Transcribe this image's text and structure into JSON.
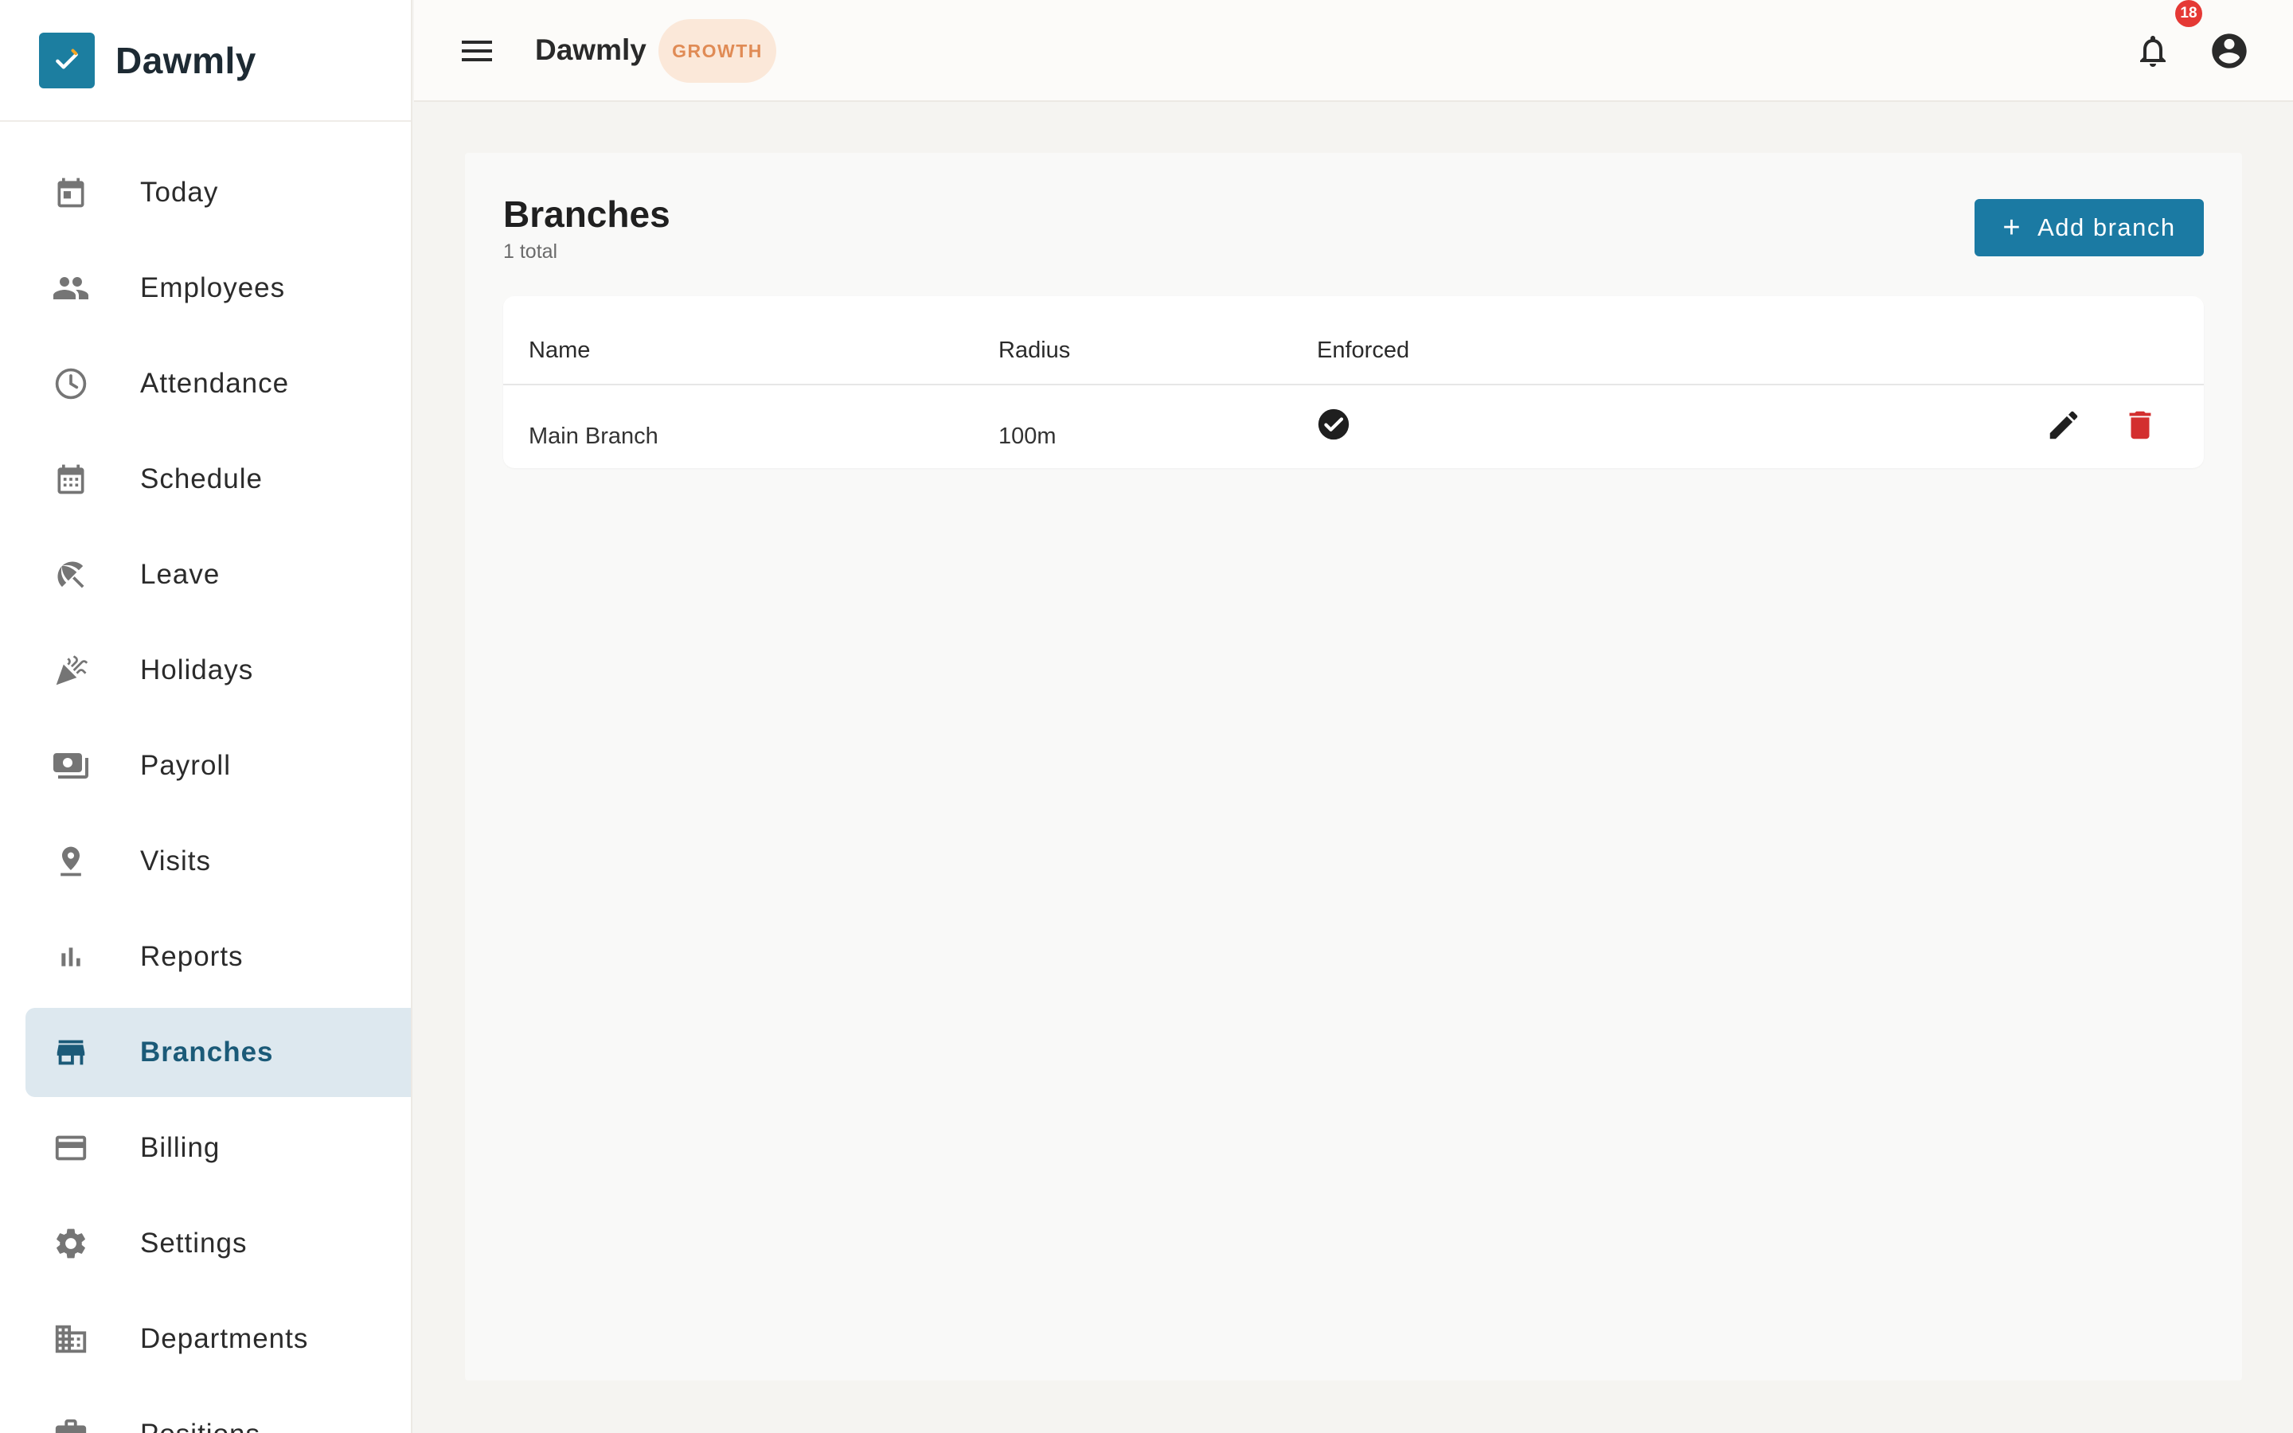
{
  "brand": {
    "name": "Dawmly"
  },
  "sidebar": {
    "items": [
      {
        "label": "Today",
        "icon": "calendar-today-icon"
      },
      {
        "label": "Employees",
        "icon": "people-icon"
      },
      {
        "label": "Attendance",
        "icon": "clock-icon"
      },
      {
        "label": "Schedule",
        "icon": "calendar-grid-icon"
      },
      {
        "label": "Leave",
        "icon": "beach-umbrella-icon"
      },
      {
        "label": "Holidays",
        "icon": "party-popper-icon"
      },
      {
        "label": "Payroll",
        "icon": "money-icon"
      },
      {
        "label": "Visits",
        "icon": "location-pin-icon"
      },
      {
        "label": "Reports",
        "icon": "bar-chart-icon"
      },
      {
        "label": "Branches",
        "icon": "storefront-icon",
        "active": true
      },
      {
        "label": "Billing",
        "icon": "credit-card-icon"
      },
      {
        "label": "Settings",
        "icon": "gear-icon"
      },
      {
        "label": "Departments",
        "icon": "building-icon"
      },
      {
        "label": "Positions",
        "icon": "briefcase-icon"
      }
    ]
  },
  "topbar": {
    "title": "Dawmly",
    "plan": "GROWTH",
    "notifications": "18"
  },
  "page": {
    "title": "Branches",
    "subtitle": "1 total",
    "add_label": "Add branch"
  },
  "table": {
    "headers": {
      "name": "Name",
      "radius": "Radius",
      "enforced": "Enforced"
    },
    "rows": [
      {
        "name": "Main Branch",
        "radius": "100m",
        "enforced": true
      }
    ]
  },
  "colors": {
    "accent": "#1b7aa3",
    "active_bg": "#dde8ef",
    "active_text": "#1b5a78",
    "badge_bg": "#fbe8d9",
    "badge_text": "#e08b55",
    "danger": "#d32f2f"
  }
}
